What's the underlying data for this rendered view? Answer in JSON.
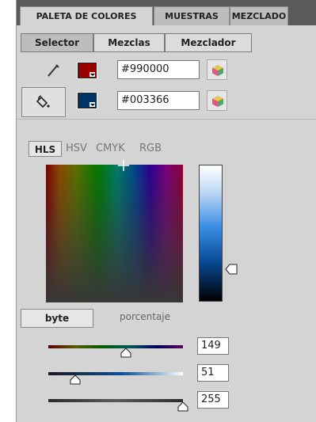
{
  "panel_tabs": [
    "PALETA DE COLORES",
    "MUESTRAS",
    "MEZCLADO"
  ],
  "sub_tabs": [
    "Selector",
    "Mezclas",
    "Mezclador"
  ],
  "stroke_color": {
    "hex": "#990000",
    "icon": "eyedropper-icon"
  },
  "fill_color": {
    "hex": "#003366",
    "icon": "paint-bucket-icon"
  },
  "color_models": [
    "HLS",
    "HSV",
    "CMYK",
    "RGB"
  ],
  "units": [
    "byte",
    "porcentaje"
  ],
  "sliders": [
    {
      "name": "hue",
      "value": "149"
    },
    {
      "name": "luminance",
      "value": "51"
    },
    {
      "name": "saturation",
      "value": "255"
    }
  ]
}
